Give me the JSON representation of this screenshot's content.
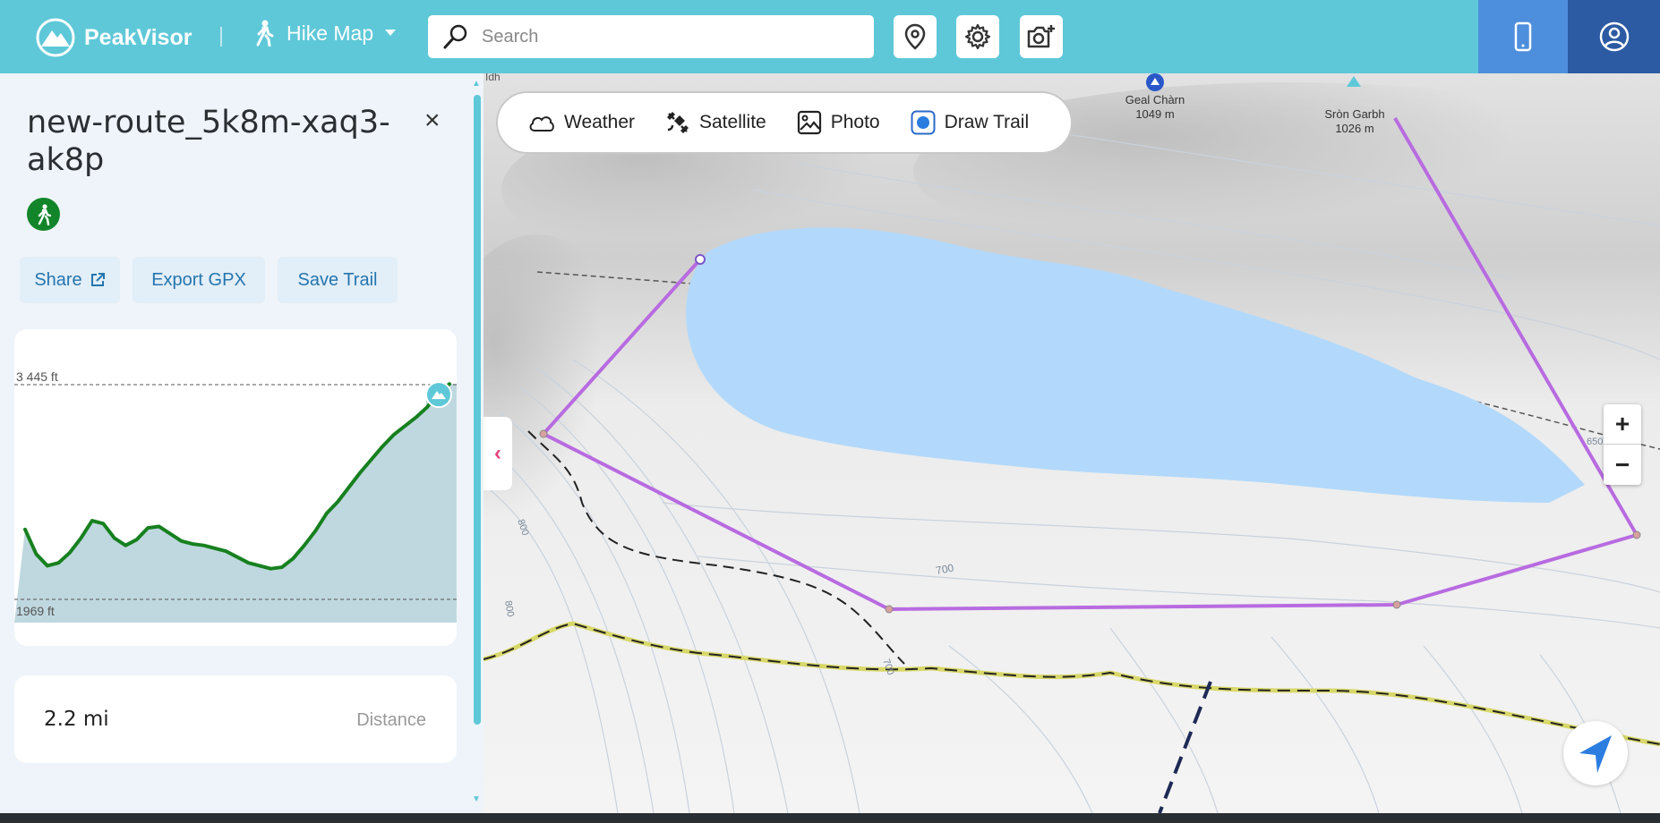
{
  "header": {
    "logo_text": "PeakVisor",
    "mode_label": "Hike Map",
    "search_placeholder": "Search"
  },
  "sidebar": {
    "route_title": "new-route_5k8m-xaq3-ak8p",
    "close_label": "×",
    "actions": {
      "share": "Share",
      "export": "Export GPX",
      "save": "Save Trail"
    },
    "elevation": {
      "max_label": "3 445 ft",
      "min_label": "1969 ft"
    },
    "stats": {
      "distance_value": "2.2 mi",
      "distance_label": "Distance"
    }
  },
  "chart_data": {
    "type": "area",
    "ylim": [
      1969,
      3445
    ],
    "y_tick_labels": [
      "3 445 ft",
      "1969 ft"
    ],
    "grid": false,
    "series": [
      {
        "values": [
          2450,
          2280,
          2200,
          2220,
          2290,
          2390,
          2510,
          2490,
          2390,
          2340,
          2380,
          2460,
          2470,
          2420,
          2370,
          2350,
          2340,
          2320,
          2300,
          2260,
          2220,
          2200,
          2180,
          2190,
          2250,
          2340,
          2440,
          2560,
          2640,
          2740,
          2840,
          2930,
          3020,
          3100,
          3160,
          3220,
          3290,
          3390,
          3450
        ]
      }
    ]
  },
  "map": {
    "collapse_label": "‹",
    "layers": {
      "weather": "Weather",
      "satellite": "Satellite",
      "photo": "Photo",
      "draw": "Draw Trail"
    },
    "zoom_in": "+",
    "zoom_out": "−",
    "peaks": [
      {
        "name": "Geal Chàrn",
        "elevation": "1049 m"
      },
      {
        "name": "Sròn Garbh",
        "elevation": "1026 m"
      }
    ],
    "contours": {
      "c1": "700",
      "c2": "650",
      "c3": "800",
      "c4": "800",
      "c5": "700"
    },
    "edge_text": "Idh"
  },
  "colors": {
    "header": "#5ec8d8",
    "route": "#b86be0",
    "elevation_line": "#17801f",
    "lake": "#b2d9fb"
  }
}
